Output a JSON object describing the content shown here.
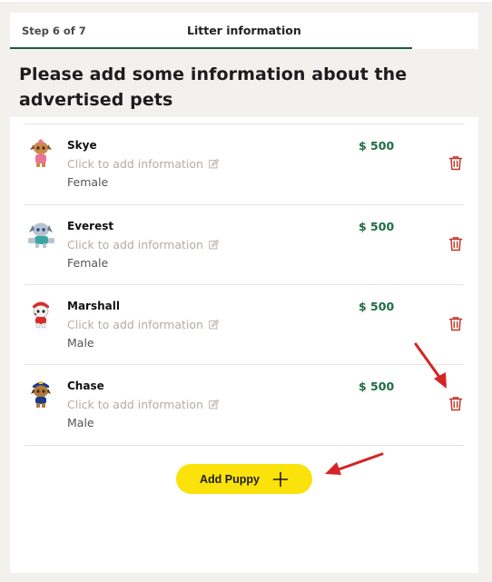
{
  "wizard": {
    "step_label": "Step 6 of 7",
    "tab_title": "Litter information",
    "accent_color": "#1f5c3f"
  },
  "page": {
    "heading": "Please add some information about the advertised pets"
  },
  "pets": [
    {
      "name": "Skye",
      "info_placeholder": "Click to add information",
      "gender": "Female",
      "price": "$ 500",
      "avatar_icon": "skye-avatar-icon"
    },
    {
      "name": "Everest",
      "info_placeholder": "Click to add information",
      "gender": "Female",
      "price": "$ 500",
      "avatar_icon": "everest-avatar-icon"
    },
    {
      "name": "Marshall",
      "info_placeholder": "Click to add information",
      "gender": "Male",
      "price": "$ 500",
      "avatar_icon": "marshall-avatar-icon"
    },
    {
      "name": "Chase",
      "info_placeholder": "Click to add information",
      "gender": "Male",
      "price": "$ 500",
      "avatar_icon": "chase-avatar-icon"
    }
  ],
  "actions": {
    "add_puppy_label": "Add Puppy",
    "add_button_color": "#fae20a",
    "delete_icon_color": "#c0392b",
    "price_color": "#1f6b46"
  },
  "annotations": {
    "arrow_color": "#d62424"
  }
}
